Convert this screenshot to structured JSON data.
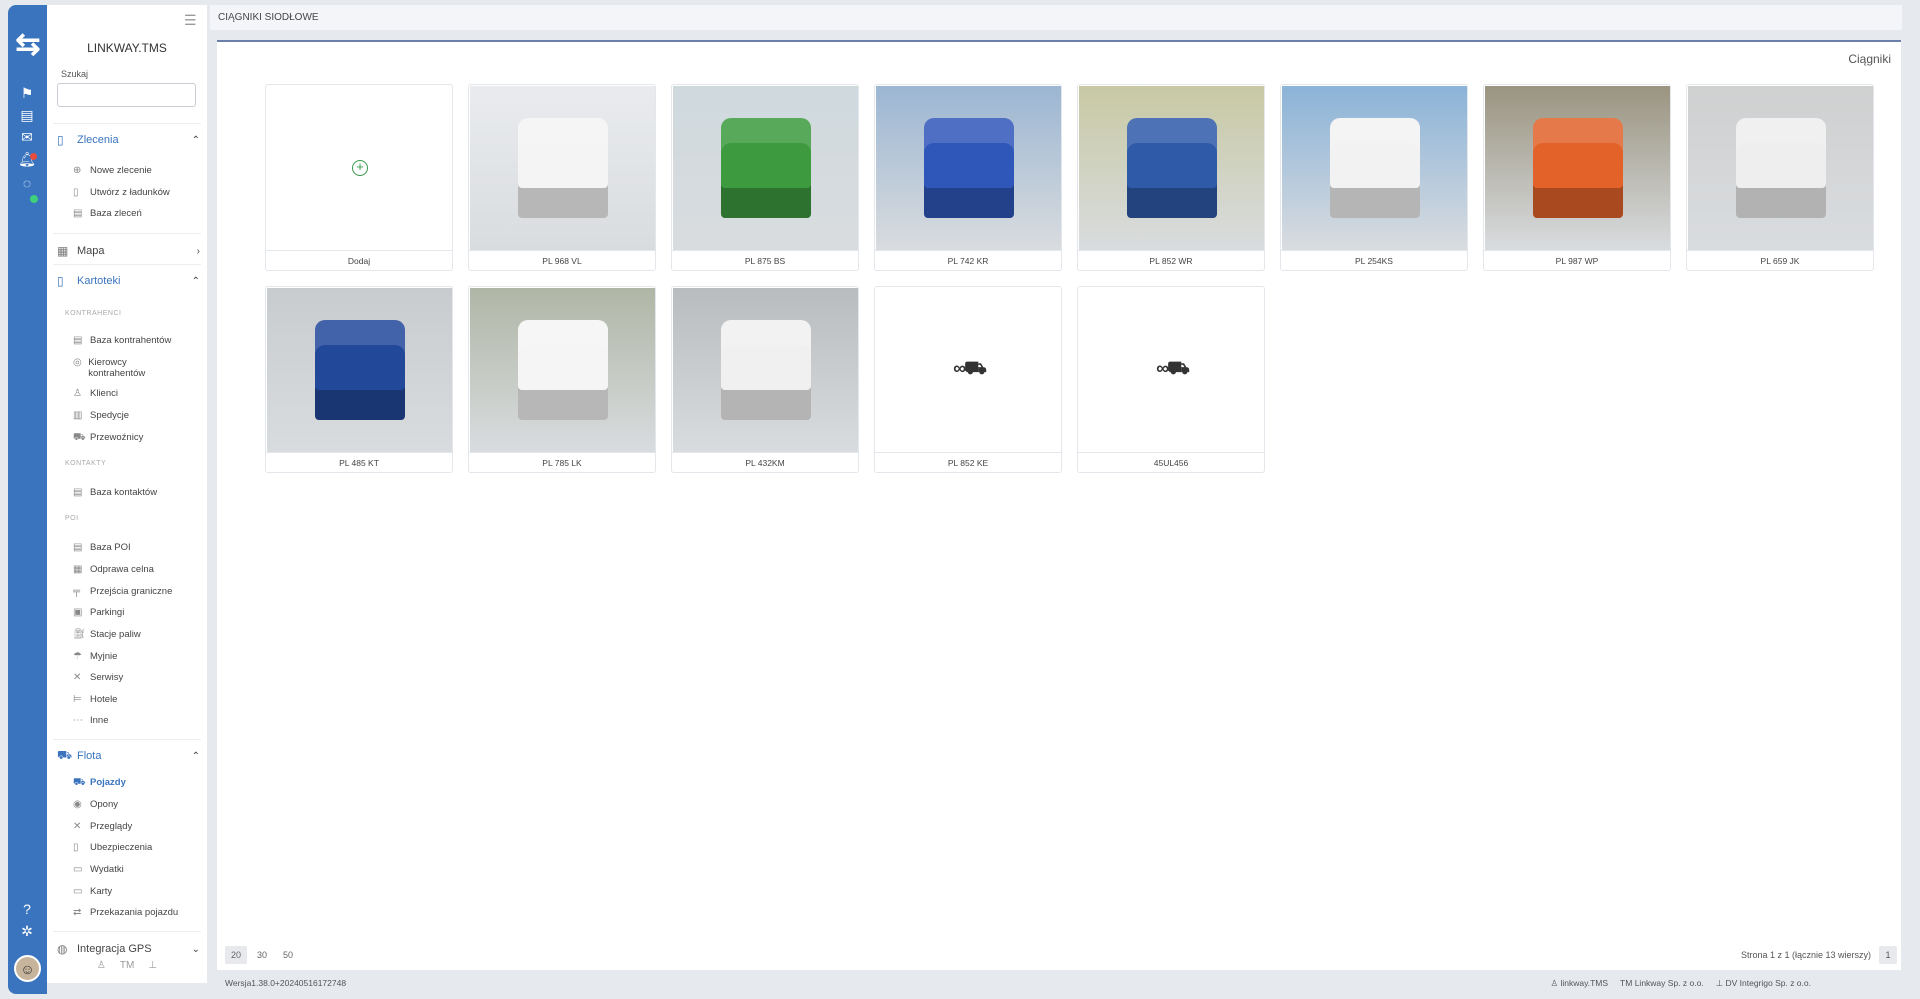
{
  "app": {
    "brand": "LINKWAY.TMS",
    "search_label": "Szukaj",
    "page_title": "CIĄGNIKI SIODŁOWE",
    "panel_title": "Ciągniki"
  },
  "sidebar": {
    "sections": [
      {
        "label": "Zlecenia",
        "icon": "document-icon",
        "chevron": "^"
      },
      {
        "label": "Mapa",
        "icon": "map-icon",
        "chevron": ">"
      },
      {
        "label": "Kartoteki",
        "icon": "folder-icon",
        "chevron": "^"
      },
      {
        "label": "Flota",
        "icon": "truck-icon",
        "chevron": "^"
      },
      {
        "label": "Integracja GPS",
        "icon": "gps-icon",
        "chevron": "v"
      }
    ],
    "zlecenia_items": [
      "Nowe zlecenie",
      "Utwórz z ładunków",
      "Baza zleceń"
    ],
    "groups": [
      "KONTRAHENCI",
      "KONTAKTY",
      "POI"
    ],
    "kontrahenci_items": [
      "Baza kontrahentów",
      "Kierowcy kontrahentów",
      "Klienci",
      "Spedycje",
      "Przewoźnicy"
    ],
    "kontakty_items": [
      "Baza kontaktów"
    ],
    "poi_items": [
      "Baza POI",
      "Odprawa celna",
      "Przejścia graniczne",
      "Parkingi",
      "Stacje paliw",
      "Myjnie",
      "Serwisy",
      "Hotele",
      "Inne"
    ],
    "flota_items": [
      "Pojazdy",
      "Opony",
      "Przeglądy",
      "Ubezpieczenia",
      "Wydatki",
      "Karty",
      "Przekazania pojazdu"
    ],
    "bottom_icons": [
      "users-icon",
      "TM",
      "network-icon"
    ]
  },
  "cards": [
    {
      "label": "Dodaj",
      "kind": "add"
    },
    {
      "label": "PL 968 VL",
      "kind": "photo",
      "color": "#e9ebee",
      "cab": "#f4f4f4"
    },
    {
      "label": "PL 875 BS",
      "kind": "photo",
      "color": "#cfd9de",
      "cab": "#3d9a3f"
    },
    {
      "label": "PL 742 KR",
      "kind": "photo",
      "color": "#9cb6d2",
      "cab": "#2f56b9"
    },
    {
      "label": "PL 852 WR",
      "kind": "photo",
      "color": "#c8c9a4",
      "cab": "#2e5aa8"
    },
    {
      "label": "PL 254KS",
      "kind": "photo",
      "color": "#8bb3d8",
      "cab": "#f2f2f2"
    },
    {
      "label": "PL 987 WP",
      "kind": "photo",
      "color": "#9a9480",
      "cab": "#e2622a"
    },
    {
      "label": "PL 659 JK",
      "kind": "photo",
      "color": "#cfd0d0",
      "cab": "#eeeeee"
    },
    {
      "label": "PL 485 KT",
      "kind": "photo",
      "color": "#c9cccf",
      "cab": "#22489a"
    },
    {
      "label": "PL 785 LK",
      "kind": "photo",
      "color": "#b0b6a6",
      "cab": "#f5f5f5"
    },
    {
      "label": "PL 432KM",
      "kind": "photo",
      "color": "#b9bcbe",
      "cab": "#f0f0f0"
    },
    {
      "label": "PL 852 KE",
      "kind": "placeholder"
    },
    {
      "label": "45UL456",
      "kind": "placeholder"
    }
  ],
  "pager": {
    "sizes": [
      "20",
      "30",
      "50"
    ],
    "info": "Strona 1 z 1 (łącznie 13 wierszy)",
    "current": "1"
  },
  "footer": {
    "version": "Wersja1.38.0+20240516172748",
    "company_1": "linkway.TMS",
    "company_2": "Linkway Sp. z o.o.",
    "company_3": "DV Integrigo Sp. z o.o.",
    "tm": "TM"
  },
  "colors": {
    "accent": "#3a74be",
    "active_dot": "#3fd07c",
    "add_icon": "#3a9a4a"
  }
}
